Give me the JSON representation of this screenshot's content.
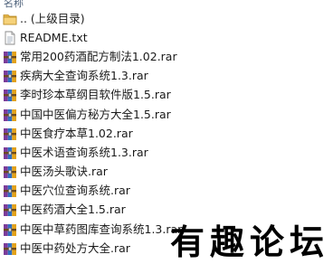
{
  "header": {
    "name_column": "名称"
  },
  "files": [
    {
      "label": ".. (上级目录)",
      "icon": "folder-icon"
    },
    {
      "label": "README.txt",
      "icon": "text-file-icon"
    },
    {
      "label": "常用200药酒配方制法1.02.rar",
      "icon": "rar-archive-icon"
    },
    {
      "label": "疾病大全查询系统1.3.rar",
      "icon": "rar-archive-icon"
    },
    {
      "label": "李时珍本草纲目软件版1.5.rar",
      "icon": "rar-archive-icon"
    },
    {
      "label": "中国中医偏方秘方大全1.5.rar",
      "icon": "rar-archive-icon"
    },
    {
      "label": "中医食疗本草1.02.rar",
      "icon": "rar-archive-icon"
    },
    {
      "label": "中医术语查询系统1.3.rar",
      "icon": "rar-archive-icon"
    },
    {
      "label": "中医汤头歌诀.rar",
      "icon": "rar-archive-icon"
    },
    {
      "label": "中医穴位查询系统.rar",
      "icon": "rar-archive-icon"
    },
    {
      "label": "中医药酒大全1.5.rar",
      "icon": "rar-archive-icon"
    },
    {
      "label": "中医中草药图库查询系统1.3.rar",
      "icon": "rar-archive-icon"
    },
    {
      "label": "中医中药处方大全.rar",
      "icon": "rar-archive-icon"
    }
  ],
  "watermark": {
    "text": "有趣论坛"
  }
}
